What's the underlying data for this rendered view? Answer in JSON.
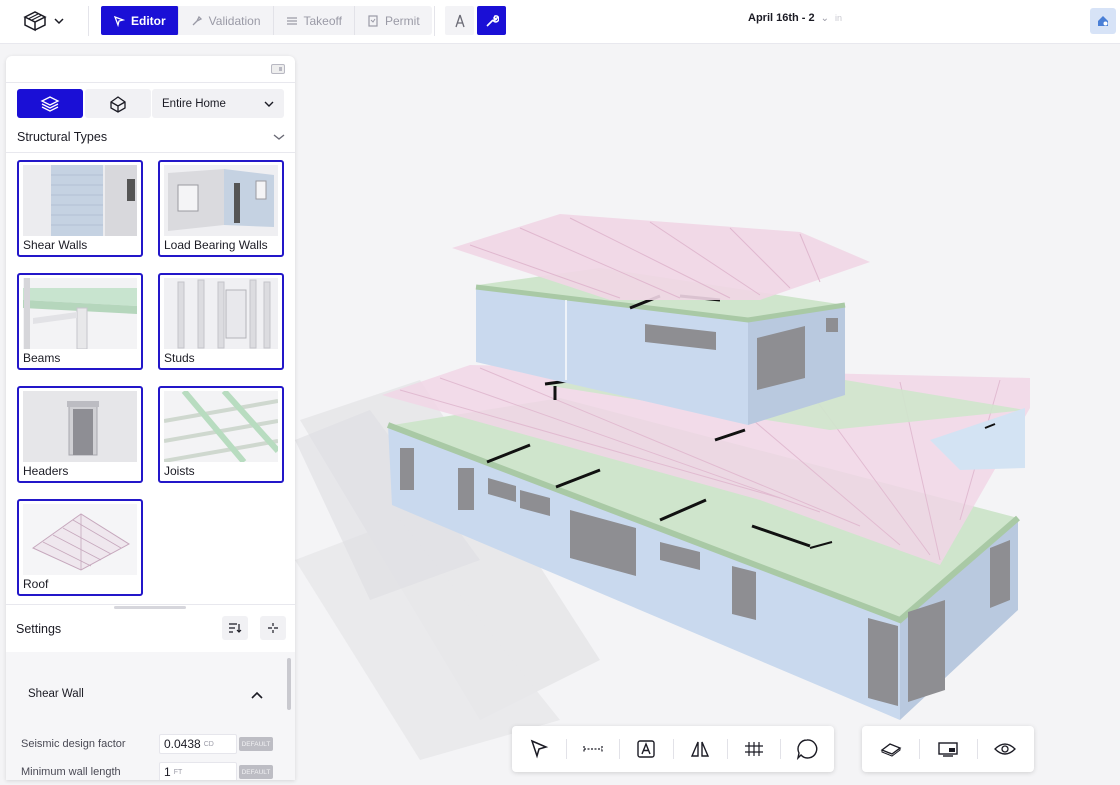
{
  "topbar": {
    "modes": [
      {
        "label": "Editor",
        "icon": "editor-icon",
        "active": true
      },
      {
        "label": "Validation",
        "icon": "validation-icon",
        "active": false
      },
      {
        "label": "Takeoff",
        "icon": "takeoff-icon",
        "active": false
      },
      {
        "label": "Permit",
        "icon": "permit-icon",
        "active": false
      }
    ],
    "date_label": "April 16th - 2",
    "date_suffix": "in",
    "accent": "#1a0fd6"
  },
  "panel": {
    "scope_value": "Entire Home",
    "section_title": "Structural Types",
    "cards": [
      {
        "label": "Shear Walls"
      },
      {
        "label": "Load Bearing Walls"
      },
      {
        "label": "Beams"
      },
      {
        "label": "Studs"
      },
      {
        "label": "Headers"
      },
      {
        "label": "Joists"
      },
      {
        "label": "Roof"
      }
    ],
    "settings_title": "Settings",
    "subsection_title": "Shear Wall",
    "fields": [
      {
        "label": "Seismic design factor",
        "value": "0.0438",
        "unit": "CD",
        "badge": "DEFAULT"
      },
      {
        "label": "Minimum wall length",
        "value": "1",
        "unit": "FT",
        "badge": "DEFAULT"
      }
    ]
  },
  "colors": {
    "wall": "#c9d9ee",
    "floor": "#d3ecd0",
    "roof": "#f1d6e6"
  }
}
